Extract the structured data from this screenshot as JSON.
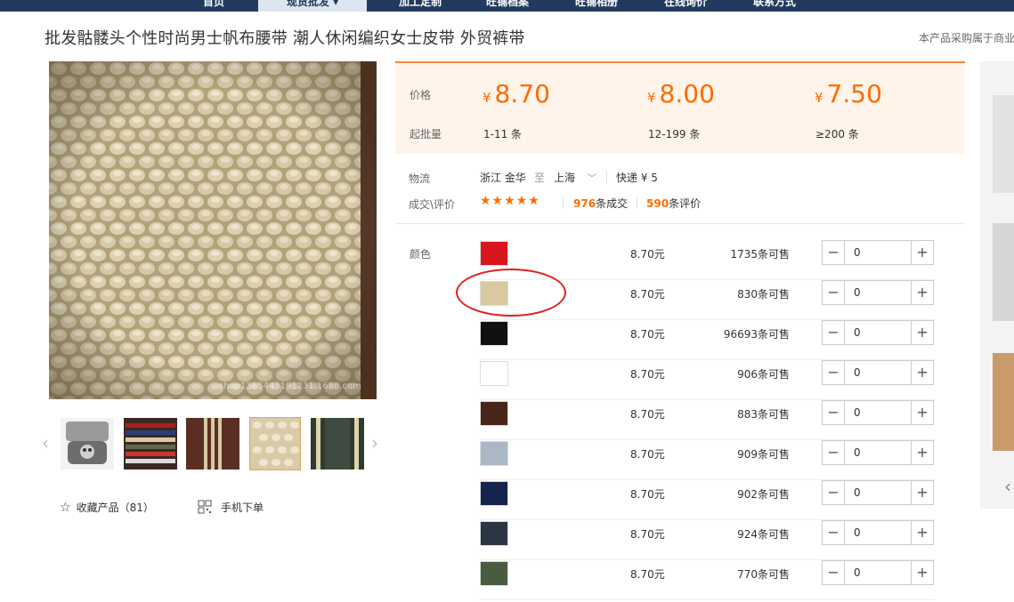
{
  "nav": {
    "items": [
      {
        "label": "首页"
      },
      {
        "label": "现货批发 ▾",
        "active": true
      },
      {
        "label": "加工定制"
      },
      {
        "label": "旺铺档案"
      },
      {
        "label": "旺铺相册"
      },
      {
        "label": "在线询价"
      },
      {
        "label": "联系方式"
      }
    ]
  },
  "product": {
    "title": "批发骷髅头个性时尚男士帆布腰带 潮人休闲编织女士皮带 外贸裤带",
    "note": "本产品采购属于商业",
    "watermark": "shop1365443191231.1688.com"
  },
  "actions": {
    "favorite": "收藏产品（81）",
    "mobile_order": "手机下单"
  },
  "pricing": {
    "price_label": "价格",
    "moq_label": "起批量",
    "currency": "¥",
    "tiers": [
      {
        "price": "8.70",
        "range": "1-11 条"
      },
      {
        "price": "8.00",
        "range": "12-199 条"
      },
      {
        "price": "7.50",
        "range": "≥200 条"
      }
    ]
  },
  "logistics": {
    "label": "物流",
    "from": "浙江 金华",
    "to_word": "至",
    "to": "上海",
    "express": "快递 ¥ 5"
  },
  "deal": {
    "label": "成交\\评价",
    "stars": "★★★★★",
    "deals_count": "976",
    "deals_suffix": "条成交",
    "reviews_count": "590",
    "reviews_suffix": "条评价"
  },
  "variants": {
    "label": "颜色",
    "rows": [
      {
        "color": "#d8161e",
        "price": "8.70元",
        "stock": "1735条可售",
        "qty": "0"
      },
      {
        "color": "#d9c9a1",
        "price": "8.70元",
        "stock": "830条可售",
        "qty": "0"
      },
      {
        "color": "#111111",
        "price": "8.70元",
        "stock": "96693条可售",
        "qty": "0"
      },
      {
        "color": "#ffffff",
        "price": "8.70元",
        "stock": "906条可售",
        "qty": "0"
      },
      {
        "color": "#4a2418",
        "price": "8.70元",
        "stock": "883条可售",
        "qty": "0"
      },
      {
        "color": "#aab7c6",
        "price": "8.70元",
        "stock": "909条可售",
        "qty": "0"
      },
      {
        "color": "#15234f",
        "price": "8.70元",
        "stock": "902条可售",
        "qty": "0"
      },
      {
        "color": "#2c3544",
        "price": "8.70元",
        "stock": "924条可售",
        "qty": "0"
      },
      {
        "color": "#4a5c3f",
        "price": "8.70元",
        "stock": "770条可售",
        "qty": "0"
      }
    ]
  },
  "stepper": {
    "minus": "−",
    "plus": "+"
  },
  "icons": {
    "star": "star-outline-icon",
    "qr": "qr-code-icon",
    "chevron_left": "chevron-left-icon",
    "chevron_right": "chevron-right-icon"
  },
  "colors": {
    "accent": "#ff6a00",
    "nav_bg": "#223a5e"
  }
}
